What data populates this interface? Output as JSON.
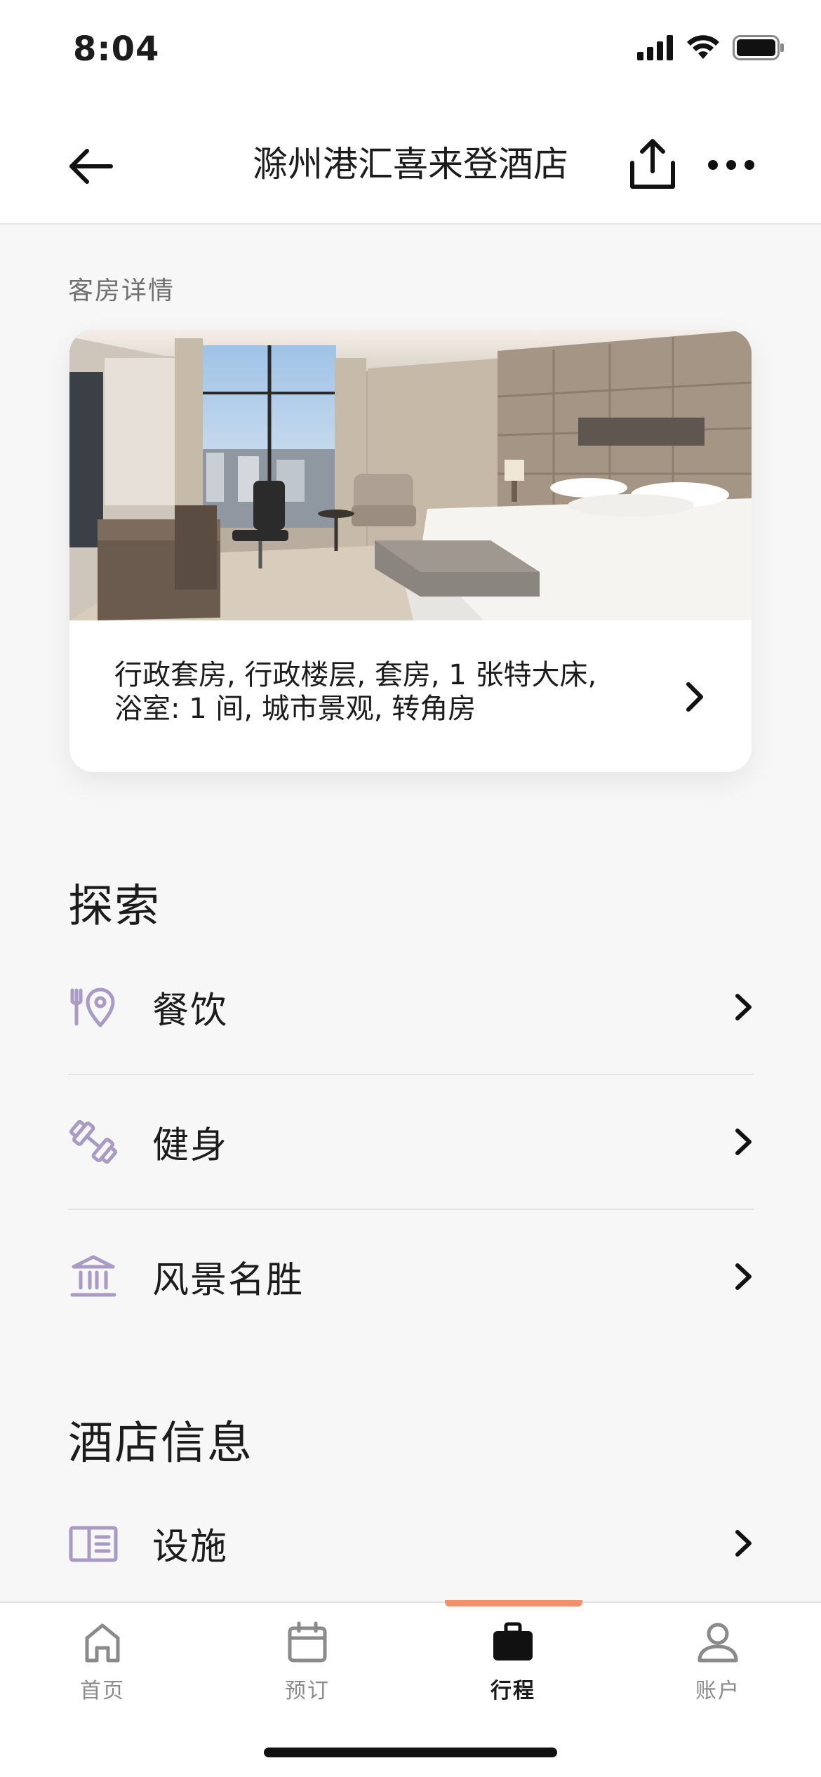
{
  "status_bar": {
    "time": "8:04"
  },
  "nav": {
    "title": "滁州港汇喜来登酒店"
  },
  "room": {
    "section_label": "客房详情",
    "description_line1": "行政套房, 行政楼层, 套房, 1 张特大床,",
    "description_line2": "浴室: 1 间, 城市景观, 转角房"
  },
  "explore": {
    "heading": "探索",
    "items": [
      {
        "label": "餐饮",
        "icon": "dining-location-icon"
      },
      {
        "label": "健身",
        "icon": "dumbbell-icon"
      },
      {
        "label": "风景名胜",
        "icon": "landmark-icon"
      }
    ]
  },
  "hotel_info": {
    "heading": "酒店信息",
    "items": [
      {
        "label": "设施",
        "icon": "facilities-book-icon"
      }
    ]
  },
  "tabs": [
    {
      "label": "首页",
      "icon": "home-icon",
      "active": false
    },
    {
      "label": "预订",
      "icon": "calendar-icon",
      "active": false
    },
    {
      "label": "行程",
      "icon": "briefcase-icon",
      "active": true
    },
    {
      "label": "账户",
      "icon": "person-icon",
      "active": false
    }
  ],
  "colors": {
    "accent_icon": "#a99bc4",
    "tab_indicator": "#f0916b",
    "text": "#1c1c1c",
    "muted": "#8a8a8a"
  }
}
